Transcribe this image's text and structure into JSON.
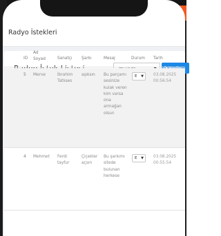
{
  "header": {
    "title": "Radyo İstekleri"
  },
  "card": {
    "title": "Radyo İstek Listesi",
    "status_filter": "Yayında",
    "refresh_label": "Yenile"
  },
  "table": {
    "columns": [
      "ID",
      "Ad Soyad",
      "Sanatçı",
      "Şarkı",
      "Mesaj",
      "Durum",
      "Tarih"
    ],
    "rows": [
      {
        "id": "5",
        "name": "Merve",
        "artist": "İbrahim Tatlıses",
        "song": "aşıksın",
        "message": "Bu parçamı sesinize kulak veren kim varsa ona armağan olsun",
        "status": "E",
        "date": "03.08.2025 00:56:54"
      },
      {
        "id": "4",
        "name": "Mehmet",
        "artist": "Ferdi tayfur",
        "song": "Çiçekler açsın",
        "message": "Bu şarkımı sitede bulunan herkese",
        "status": "E",
        "date": "03.08.2025 00:55:54"
      }
    ]
  }
}
